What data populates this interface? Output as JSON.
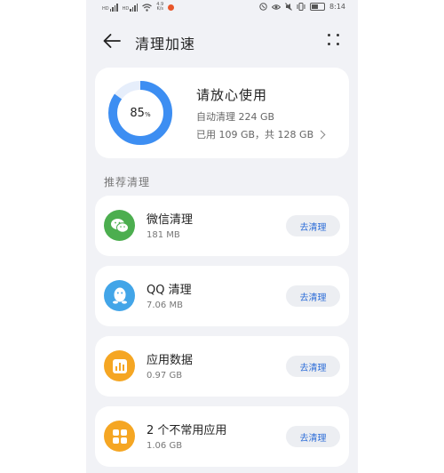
{
  "statusbar": {
    "left_sig1": "HD",
    "left_sig2": "HD",
    "netspeed_value": "4.9",
    "netspeed_unit": "K/s",
    "time": "8:14"
  },
  "header": {
    "title": "清理加速"
  },
  "storage": {
    "percent": "85",
    "percent_sign": "%",
    "percent_value": 85,
    "title": "请放心使用",
    "auto_clean": "自动清理 224 GB",
    "usage": "已用 109 GB，共 128 GB",
    "ring_color": "#3d8ef2",
    "ring_track_color": "#e6eefb"
  },
  "section": {
    "label": "推荐清理"
  },
  "items": [
    {
      "name": "微信清理",
      "size": "181 MB",
      "button": "去清理",
      "icon": "wechat-icon",
      "color": "#4cae4f"
    },
    {
      "name": "QQ 清理",
      "size": "7.06 MB",
      "button": "去清理",
      "icon": "qq-icon",
      "color": "#42a5e8"
    },
    {
      "name": "应用数据",
      "size": "0.97 GB",
      "button": "去清理",
      "icon": "app-data-icon",
      "color": "#f5a623"
    },
    {
      "name": "2 个不常用应用",
      "size": "1.06 GB",
      "button": "去清理",
      "icon": "apps-grid-icon",
      "color": "#f5a623"
    }
  ],
  "colors": {
    "accent_blue": "#2f6fd8",
    "page_bg": "#f1f2f6"
  }
}
